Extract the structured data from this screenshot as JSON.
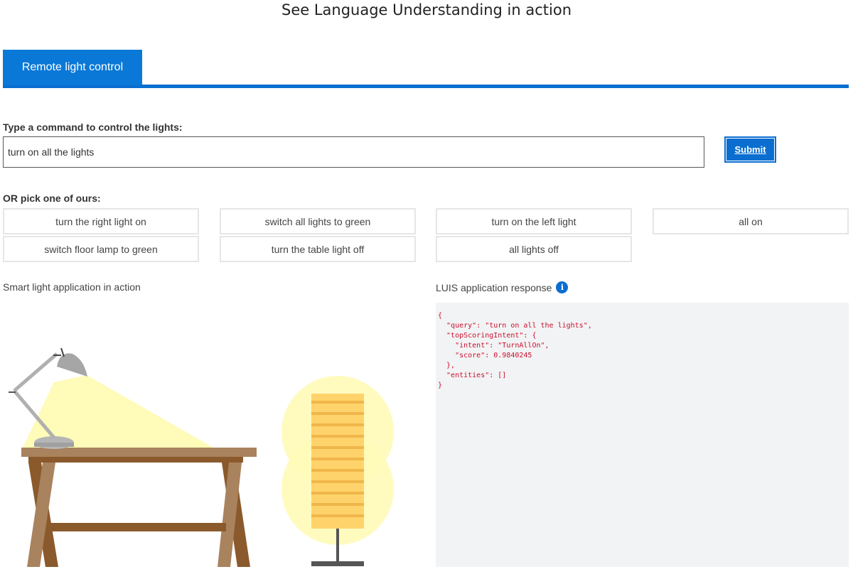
{
  "page_title": "See Language Understanding in action",
  "tabs": [
    {
      "label": "Remote light control"
    }
  ],
  "command": {
    "label": "Type a command to control the lights:",
    "value": "turn on all the lights",
    "submit_label": "Submit"
  },
  "pick": {
    "label": "OR pick one of ours:",
    "options": [
      "turn the right light on",
      "switch all lights to green",
      "turn on the left light",
      "all on",
      "switch floor lamp to green",
      "turn the table light off",
      "all lights off"
    ]
  },
  "scene": {
    "label": "Smart light application in action",
    "lights": {
      "desk_lamp": "on",
      "floor_lamp": "on"
    }
  },
  "luis": {
    "label": "LUIS application response",
    "info_icon": "info-icon",
    "response": "{\n  \"query\": \"turn on all the lights\",\n  \"topScoringIntent\": {\n    \"intent\": \"TurnAllOn\",\n    \"score\": 0.9840245\n  },\n  \"entities\": []\n}"
  },
  "colors": {
    "accent": "#0a78d7",
    "json_text": "#c8102e",
    "light_glow": "#fffbb8"
  }
}
